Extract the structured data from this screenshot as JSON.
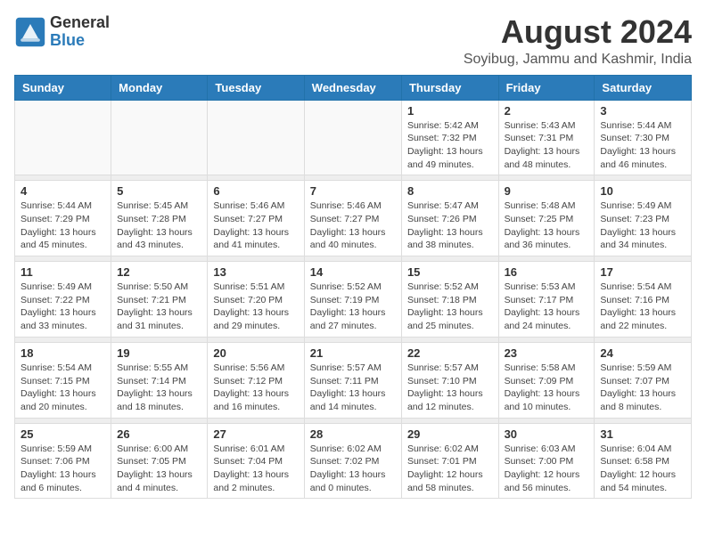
{
  "logo": {
    "line1": "General",
    "line2": "Blue"
  },
  "title": "August 2024",
  "subtitle": "Soyibug, Jammu and Kashmir, India",
  "weekdays": [
    "Sunday",
    "Monday",
    "Tuesday",
    "Wednesday",
    "Thursday",
    "Friday",
    "Saturday"
  ],
  "weeks": [
    [
      {
        "day": "",
        "sunrise": "",
        "sunset": "",
        "daylight": ""
      },
      {
        "day": "",
        "sunrise": "",
        "sunset": "",
        "daylight": ""
      },
      {
        "day": "",
        "sunrise": "",
        "sunset": "",
        "daylight": ""
      },
      {
        "day": "",
        "sunrise": "",
        "sunset": "",
        "daylight": ""
      },
      {
        "day": "1",
        "sunrise": "Sunrise: 5:42 AM",
        "sunset": "Sunset: 7:32 PM",
        "daylight": "Daylight: 13 hours and 49 minutes."
      },
      {
        "day": "2",
        "sunrise": "Sunrise: 5:43 AM",
        "sunset": "Sunset: 7:31 PM",
        "daylight": "Daylight: 13 hours and 48 minutes."
      },
      {
        "day": "3",
        "sunrise": "Sunrise: 5:44 AM",
        "sunset": "Sunset: 7:30 PM",
        "daylight": "Daylight: 13 hours and 46 minutes."
      }
    ],
    [
      {
        "day": "4",
        "sunrise": "Sunrise: 5:44 AM",
        "sunset": "Sunset: 7:29 PM",
        "daylight": "Daylight: 13 hours and 45 minutes."
      },
      {
        "day": "5",
        "sunrise": "Sunrise: 5:45 AM",
        "sunset": "Sunset: 7:28 PM",
        "daylight": "Daylight: 13 hours and 43 minutes."
      },
      {
        "day": "6",
        "sunrise": "Sunrise: 5:46 AM",
        "sunset": "Sunset: 7:27 PM",
        "daylight": "Daylight: 13 hours and 41 minutes."
      },
      {
        "day": "7",
        "sunrise": "Sunrise: 5:46 AM",
        "sunset": "Sunset: 7:27 PM",
        "daylight": "Daylight: 13 hours and 40 minutes."
      },
      {
        "day": "8",
        "sunrise": "Sunrise: 5:47 AM",
        "sunset": "Sunset: 7:26 PM",
        "daylight": "Daylight: 13 hours and 38 minutes."
      },
      {
        "day": "9",
        "sunrise": "Sunrise: 5:48 AM",
        "sunset": "Sunset: 7:25 PM",
        "daylight": "Daylight: 13 hours and 36 minutes."
      },
      {
        "day": "10",
        "sunrise": "Sunrise: 5:49 AM",
        "sunset": "Sunset: 7:23 PM",
        "daylight": "Daylight: 13 hours and 34 minutes."
      }
    ],
    [
      {
        "day": "11",
        "sunrise": "Sunrise: 5:49 AM",
        "sunset": "Sunset: 7:22 PM",
        "daylight": "Daylight: 13 hours and 33 minutes."
      },
      {
        "day": "12",
        "sunrise": "Sunrise: 5:50 AM",
        "sunset": "Sunset: 7:21 PM",
        "daylight": "Daylight: 13 hours and 31 minutes."
      },
      {
        "day": "13",
        "sunrise": "Sunrise: 5:51 AM",
        "sunset": "Sunset: 7:20 PM",
        "daylight": "Daylight: 13 hours and 29 minutes."
      },
      {
        "day": "14",
        "sunrise": "Sunrise: 5:52 AM",
        "sunset": "Sunset: 7:19 PM",
        "daylight": "Daylight: 13 hours and 27 minutes."
      },
      {
        "day": "15",
        "sunrise": "Sunrise: 5:52 AM",
        "sunset": "Sunset: 7:18 PM",
        "daylight": "Daylight: 13 hours and 25 minutes."
      },
      {
        "day": "16",
        "sunrise": "Sunrise: 5:53 AM",
        "sunset": "Sunset: 7:17 PM",
        "daylight": "Daylight: 13 hours and 24 minutes."
      },
      {
        "day": "17",
        "sunrise": "Sunrise: 5:54 AM",
        "sunset": "Sunset: 7:16 PM",
        "daylight": "Daylight: 13 hours and 22 minutes."
      }
    ],
    [
      {
        "day": "18",
        "sunrise": "Sunrise: 5:54 AM",
        "sunset": "Sunset: 7:15 PM",
        "daylight": "Daylight: 13 hours and 20 minutes."
      },
      {
        "day": "19",
        "sunrise": "Sunrise: 5:55 AM",
        "sunset": "Sunset: 7:14 PM",
        "daylight": "Daylight: 13 hours and 18 minutes."
      },
      {
        "day": "20",
        "sunrise": "Sunrise: 5:56 AM",
        "sunset": "Sunset: 7:12 PM",
        "daylight": "Daylight: 13 hours and 16 minutes."
      },
      {
        "day": "21",
        "sunrise": "Sunrise: 5:57 AM",
        "sunset": "Sunset: 7:11 PM",
        "daylight": "Daylight: 13 hours and 14 minutes."
      },
      {
        "day": "22",
        "sunrise": "Sunrise: 5:57 AM",
        "sunset": "Sunset: 7:10 PM",
        "daylight": "Daylight: 13 hours and 12 minutes."
      },
      {
        "day": "23",
        "sunrise": "Sunrise: 5:58 AM",
        "sunset": "Sunset: 7:09 PM",
        "daylight": "Daylight: 13 hours and 10 minutes."
      },
      {
        "day": "24",
        "sunrise": "Sunrise: 5:59 AM",
        "sunset": "Sunset: 7:07 PM",
        "daylight": "Daylight: 13 hours and 8 minutes."
      }
    ],
    [
      {
        "day": "25",
        "sunrise": "Sunrise: 5:59 AM",
        "sunset": "Sunset: 7:06 PM",
        "daylight": "Daylight: 13 hours and 6 minutes."
      },
      {
        "day": "26",
        "sunrise": "Sunrise: 6:00 AM",
        "sunset": "Sunset: 7:05 PM",
        "daylight": "Daylight: 13 hours and 4 minutes."
      },
      {
        "day": "27",
        "sunrise": "Sunrise: 6:01 AM",
        "sunset": "Sunset: 7:04 PM",
        "daylight": "Daylight: 13 hours and 2 minutes."
      },
      {
        "day": "28",
        "sunrise": "Sunrise: 6:02 AM",
        "sunset": "Sunset: 7:02 PM",
        "daylight": "Daylight: 13 hours and 0 minutes."
      },
      {
        "day": "29",
        "sunrise": "Sunrise: 6:02 AM",
        "sunset": "Sunset: 7:01 PM",
        "daylight": "Daylight: 12 hours and 58 minutes."
      },
      {
        "day": "30",
        "sunrise": "Sunrise: 6:03 AM",
        "sunset": "Sunset: 7:00 PM",
        "daylight": "Daylight: 12 hours and 56 minutes."
      },
      {
        "day": "31",
        "sunrise": "Sunrise: 6:04 AM",
        "sunset": "Sunset: 6:58 PM",
        "daylight": "Daylight: 12 hours and 54 minutes."
      }
    ]
  ]
}
